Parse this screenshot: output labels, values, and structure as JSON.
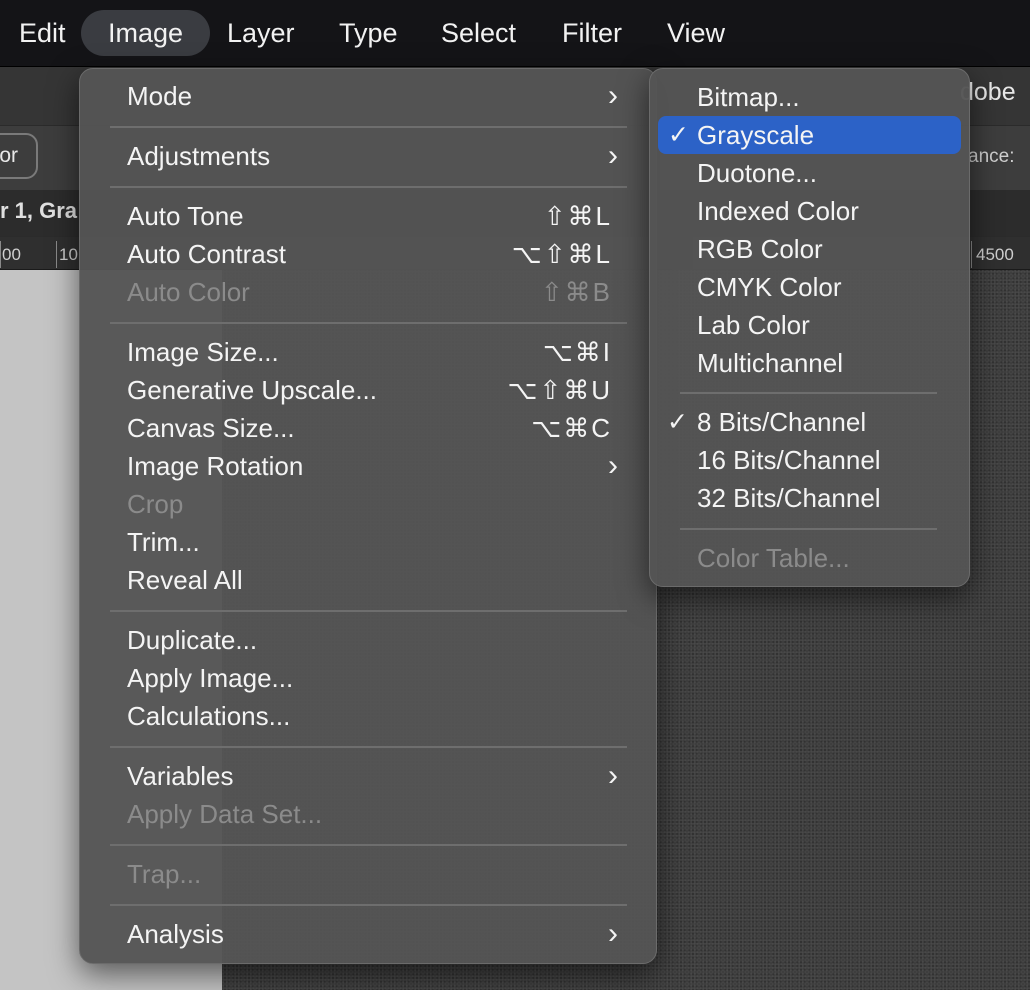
{
  "menubar": {
    "items": [
      "Edit",
      "Image",
      "Layer",
      "Type",
      "Select",
      "Filter",
      "View"
    ]
  },
  "background": {
    "app_title": "dobe",
    "color_button": "or",
    "tolerance_label": "ance:",
    "doc_tab": "r 1, Gra",
    "ruler": [
      "00",
      "10",
      "4500"
    ]
  },
  "image_menu": {
    "items": [
      {
        "label": "Mode",
        "submenu": true
      },
      {
        "label": "Adjustments",
        "submenu": true
      },
      {
        "label": "Auto Tone",
        "shortcut": "⇧⌘L"
      },
      {
        "label": "Auto Contrast",
        "shortcut": "⌥⇧⌘L"
      },
      {
        "label": "Auto Color",
        "shortcut": "⇧⌘B",
        "disabled": true
      },
      {
        "label": "Image Size...",
        "shortcut": "⌥⌘I"
      },
      {
        "label": "Generative Upscale...",
        "shortcut": "⌥⇧⌘U"
      },
      {
        "label": "Canvas Size...",
        "shortcut": "⌥⌘C"
      },
      {
        "label": "Image Rotation",
        "submenu": true
      },
      {
        "label": "Crop",
        "disabled": true
      },
      {
        "label": "Trim..."
      },
      {
        "label": "Reveal All"
      },
      {
        "label": "Duplicate..."
      },
      {
        "label": "Apply Image..."
      },
      {
        "label": "Calculations..."
      },
      {
        "label": "Variables",
        "submenu": true
      },
      {
        "label": "Apply Data Set...",
        "disabled": true
      },
      {
        "label": "Trap...",
        "disabled": true
      },
      {
        "label": "Analysis",
        "submenu": true
      }
    ]
  },
  "mode_submenu": {
    "items": [
      {
        "label": "Bitmap..."
      },
      {
        "label": "Grayscale",
        "checked": true,
        "highlighted": true
      },
      {
        "label": "Duotone..."
      },
      {
        "label": "Indexed Color"
      },
      {
        "label": "RGB Color"
      },
      {
        "label": "CMYK Color"
      },
      {
        "label": "Lab Color"
      },
      {
        "label": "Multichannel"
      },
      {
        "label": "8 Bits/Channel",
        "checked": true
      },
      {
        "label": "16 Bits/Channel"
      },
      {
        "label": "32 Bits/Channel"
      },
      {
        "label": "Color Table...",
        "disabled": true
      }
    ]
  },
  "glyphs": {
    "chevron": "›",
    "check": "✓"
  },
  "colors": {
    "highlight": "#2c62c7",
    "menu_bg": "#545454",
    "disabled_text": "#8b8b8b"
  }
}
